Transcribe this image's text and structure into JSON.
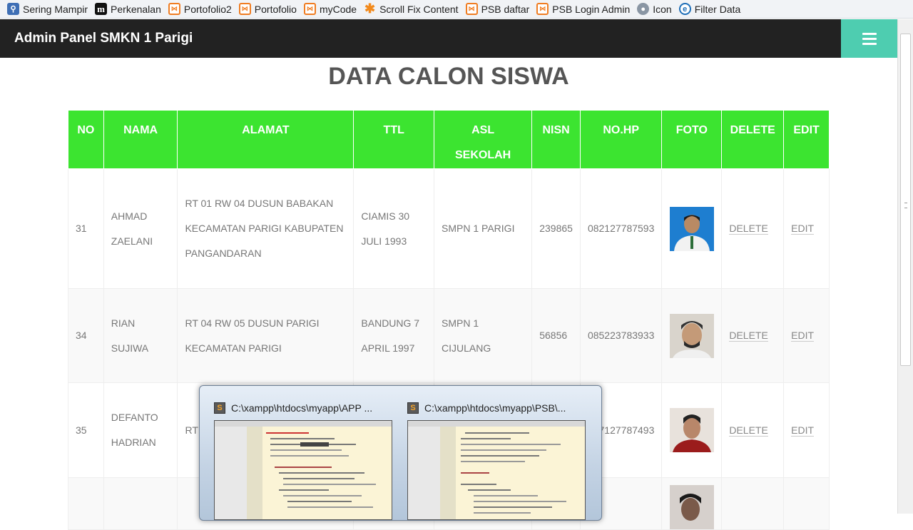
{
  "bookmarks": [
    {
      "label": "Sering Mampir",
      "icon": "search-icon"
    },
    {
      "label": "Perkenalan",
      "icon": "m-logo-icon"
    },
    {
      "label": "Portofolio2",
      "icon": "xampp-icon"
    },
    {
      "label": "Portofolio",
      "icon": "xampp-icon"
    },
    {
      "label": "myCode",
      "icon": "xampp-icon"
    },
    {
      "label": "Scroll Fix Content",
      "icon": "star-icon"
    },
    {
      "label": "PSB daftar",
      "icon": "xampp-icon"
    },
    {
      "label": "PSB Login Admin",
      "icon": "xampp-icon"
    },
    {
      "label": "Icon",
      "icon": "globe-icon"
    },
    {
      "label": "Filter Data",
      "icon": "edge-icon"
    }
  ],
  "navbar": {
    "brand": "Admin Panel SMKN 1 Parigi",
    "menu_icon": "hamburger-icon",
    "accent": "#4ecdb0"
  },
  "page": {
    "title": "DATA CALON SISWA"
  },
  "table": {
    "header_color": "#3ce430",
    "headers": {
      "no": "NO",
      "nama": "NAMA",
      "alamat": "ALAMAT",
      "ttl": "TTL",
      "asal_1": "ASL",
      "asal_2": "SEKOLAH",
      "nisn": "NISN",
      "nohp": "NO.HP",
      "foto": "FOTO",
      "delete": "DELETE",
      "edit": "EDIT"
    },
    "rows": [
      {
        "no": "31",
        "nama": "AHMAD ZAELANI",
        "alamat": "RT 01 RW 04 DUSUN BABAKAN KECAMATAN PARIGI KABUPATEN PANGANDARAN",
        "ttl": "CIAMIS 30 JULI 1993",
        "asal": "SMPN 1 PARIGI",
        "nisn": "239865",
        "nohp": "082127787593",
        "delete": "DELETE",
        "edit": "EDIT"
      },
      {
        "no": "34",
        "nama": "RIAN SUJIWA",
        "alamat": "RT 04 RW 05 DUSUN PARIGI KECAMATAN PARIGI",
        "ttl": "BANDUNG 7 APRIL 1997",
        "asal": "SMPN 1 CIJULANG",
        "nisn": "56856",
        "nohp": "085223783933",
        "delete": "DELETE",
        "edit": "EDIT"
      },
      {
        "no": "35",
        "nama": "DEFANTO HADRIAN",
        "alamat": "RT",
        "ttl": "",
        "asal": "",
        "nisn": "",
        "nohp": "087127787493",
        "delete": "DELETE",
        "edit": "EDIT"
      },
      {
        "no": "",
        "nama": "",
        "alamat": "",
        "ttl": "",
        "asal": "",
        "nisn": "",
        "nohp": "",
        "delete": "",
        "edit": ""
      }
    ]
  },
  "taskbar_preview": {
    "windows": [
      {
        "title": "C:\\xampp\\htdocs\\myapp\\APP ...",
        "icon": "sublime-text-icon"
      },
      {
        "title": "C:\\xampp\\htdocs\\myapp\\PSB\\...",
        "icon": "sublime-text-icon"
      }
    ]
  }
}
